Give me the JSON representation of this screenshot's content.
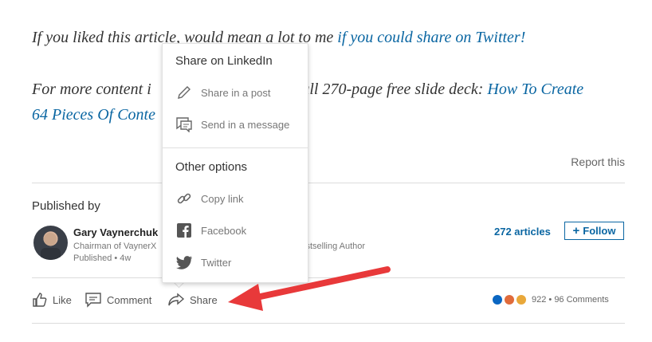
{
  "article": {
    "p1_text": "If you liked this article, would mean a lot to me ",
    "p1_link": "if you could share on Twitter!",
    "p2_prefix": "For more content i",
    "p2_suffix": "g full 270-page free slide deck: ",
    "p2_link_line1": "How To Create",
    "p2_link_line2": "64 Pieces Of Conte"
  },
  "report_label": "Report this",
  "published_by_label": "Published by",
  "author": {
    "name": "Gary Vaynerchuk",
    "title_visible": "Chairman of VaynerX",
    "title_tail": "Bestselling Author",
    "published": "Published • 4w"
  },
  "articles_count": "272 articles",
  "follow_label": "Follow",
  "actions": {
    "like": "Like",
    "comment": "Comment",
    "share": "Share"
  },
  "reactions_text": "922 • 96 Comments",
  "share_menu": {
    "linkedin_heading": "Share on LinkedIn",
    "share_post": "Share in a post",
    "send_message": "Send in a message",
    "other_heading": "Other options",
    "copy_link": "Copy link",
    "facebook": "Facebook",
    "twitter": "Twitter"
  },
  "colors": {
    "link": "#0a66a2",
    "annotation_arrow": "#e8393a"
  }
}
